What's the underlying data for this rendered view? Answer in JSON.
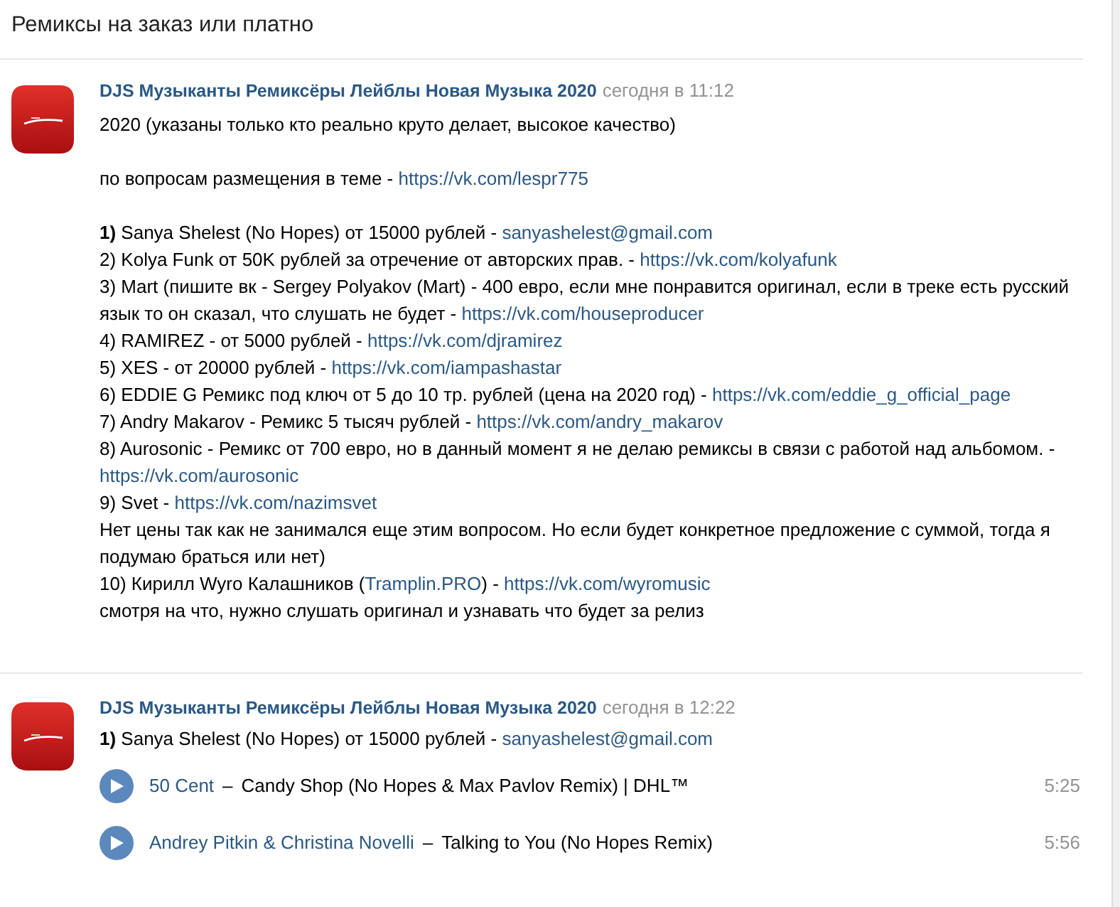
{
  "page": {
    "title": "Ремиксы на заказ или платно"
  },
  "posts": [
    {
      "author": "DJS Музыканты Ремиксёры Лейблы Новая Музыка 2020",
      "time": "сегодня в 11:12",
      "blocks": [
        {
          "lines": [
            {
              "parts": [
                {
                  "kind": "text",
                  "text": "2020 (указаны только кто реально круто делает, высокое качество)"
                }
              ]
            }
          ]
        },
        {
          "lines": [
            {
              "parts": [
                {
                  "kind": "text",
                  "text": "по вопросам размещения в теме - "
                },
                {
                  "kind": "link",
                  "text": "https://vk.com/lespr775"
                }
              ]
            }
          ]
        },
        {
          "lines": [
            {
              "parts": [
                {
                  "kind": "text",
                  "text": "**1)** Sanya Shelest (No Hopes) от 15000 рублей - "
                },
                {
                  "kind": "link",
                  "text": "sanyashelest@gmail.com"
                }
              ]
            },
            {
              "parts": [
                {
                  "kind": "text",
                  "text": "2) Kolya Funk от 50K рублей за отречение от авторских прав. - "
                },
                {
                  "kind": "link",
                  "text": "https://vk.com/kolyafunk"
                }
              ]
            },
            {
              "parts": [
                {
                  "kind": "text",
                  "text": "3) Mart (пишите вк - Sergey Polyakov (Mart) - 400 евро, если мне понравится оригинал, если в треке есть русский"
                }
              ]
            },
            {
              "parts": [
                {
                  "kind": "text",
                  "text": "язык то он сказал, что слушать не будет - "
                },
                {
                  "kind": "link",
                  "text": "https://vk.com/houseproducer"
                }
              ]
            },
            {
              "parts": [
                {
                  "kind": "text",
                  "text": "4) RAMIREZ - от 5000 рублей - "
                },
                {
                  "kind": "link",
                  "text": "https://vk.com/djramirez"
                }
              ]
            },
            {
              "parts": [
                {
                  "kind": "text",
                  "text": "5) XES - от 20000 рублей - "
                },
                {
                  "kind": "link",
                  "text": "https://vk.com/iampashastar"
                }
              ]
            },
            {
              "parts": [
                {
                  "kind": "text",
                  "text": "6) EDDIE G Ремикс под ключ от 5 до 10 тр. рублей (цена на 2020 год) - "
                },
                {
                  "kind": "link",
                  "text": "https://vk.com/eddie_g_official_page"
                }
              ]
            },
            {
              "parts": [
                {
                  "kind": "text",
                  "text": "7) Andry Makarov - Ремикс 5 тысяч рублей - "
                },
                {
                  "kind": "link",
                  "text": "https://vk.com/andry_makarov"
                }
              ]
            },
            {
              "parts": [
                {
                  "kind": "text",
                  "text": "8) Aurosonic - Ремикс от 700 евро, но в данный момент я не делаю ремиксы в связи с работой над альбомом. -"
                }
              ]
            },
            {
              "parts": [
                {
                  "kind": "link",
                  "text": "https://vk.com/aurosonic"
                }
              ]
            },
            {
              "parts": [
                {
                  "kind": "text",
                  "text": "9) Svet - "
                },
                {
                  "kind": "link",
                  "text": "https://vk.com/nazimsvet"
                }
              ]
            },
            {
              "parts": [
                {
                  "kind": "text",
                  "text": "Нет цены так как не занимался еще этим вопросом. Но если будет конкретное предложение с суммой, тогда я"
                }
              ]
            },
            {
              "parts": [
                {
                  "kind": "text",
                  "text": "подумаю браться или нет)"
                }
              ]
            },
            {
              "parts": [
                {
                  "kind": "text",
                  "text": "10) Кирилл Wyro Калашников ("
                },
                {
                  "kind": "link",
                  "text": "Tramplin.PRO"
                },
                {
                  "kind": "text",
                  "text": ") - "
                },
                {
                  "kind": "link",
                  "text": "https://vk.com/wyromusic"
                }
              ]
            },
            {
              "parts": [
                {
                  "kind": "text",
                  "text": "смотря на что, нужно слушать оригинал и узнавать что будет за релиз"
                }
              ]
            }
          ]
        }
      ]
    },
    {
      "author": "DJS Музыканты Ремиксёры Лейблы Новая Музыка 2020",
      "time": "сегодня в 12:22",
      "blocks": [
        {
          "lines": [
            {
              "parts": [
                {
                  "kind": "text",
                  "text": "**1)** Sanya Shelest (No Hopes) от 15000 рублей - "
                },
                {
                  "kind": "link",
                  "text": "sanyashelest@gmail.com"
                }
              ]
            }
          ]
        }
      ],
      "tracks": [
        {
          "artist": "50 Cent",
          "dash": "–",
          "title": "Candy Shop (No Hopes & Max Pavlov Remix) | DHL™",
          "duration": "5:25"
        },
        {
          "artist": "Andrey Pitkin & Christina Novelli",
          "dash": "–",
          "title": "Talking to You (No Hopes Remix)",
          "duration": "5:56"
        }
      ]
    }
  ]
}
